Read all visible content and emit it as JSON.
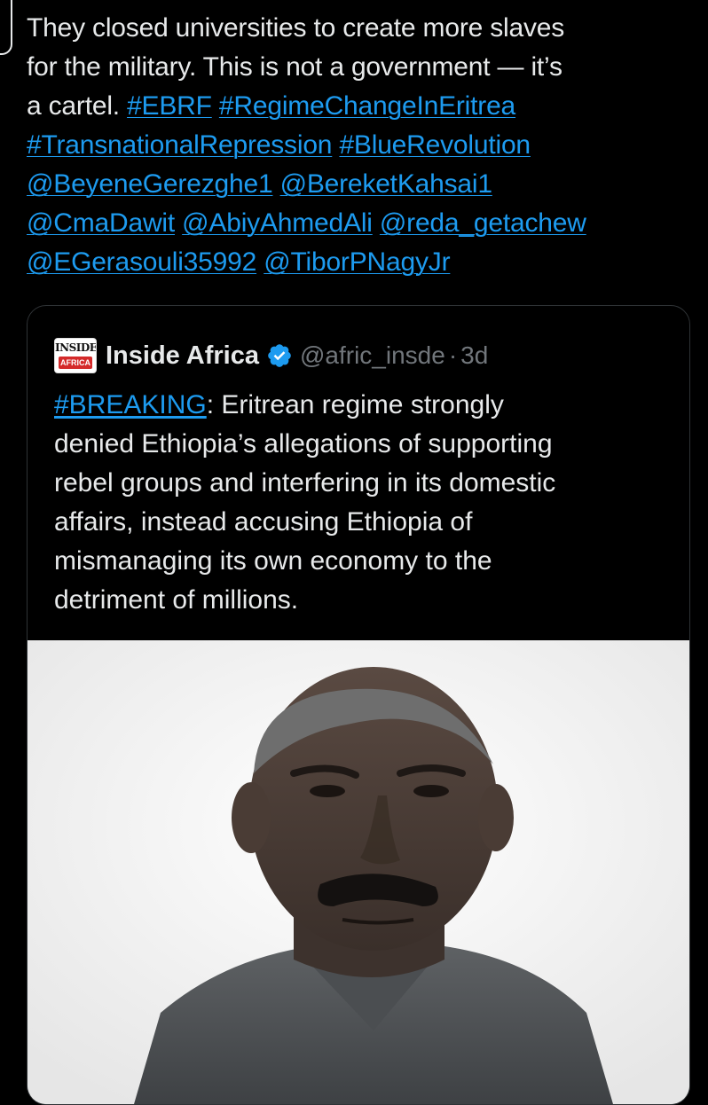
{
  "tweet": {
    "text_lines": [
      {
        "parts": [
          {
            "t": "They closed universities to create more slaves",
            "link": false
          }
        ]
      },
      {
        "parts": [
          {
            "t": "for the military. This is not a government — it’s",
            "link": false
          }
        ]
      },
      {
        "parts": [
          {
            "t": "a cartel. ",
            "link": false
          },
          {
            "t": "#EBRF",
            "link": true
          },
          {
            "t": " ",
            "link": false
          },
          {
            "t": "#RegimeChangeInEritrea",
            "link": true
          }
        ]
      },
      {
        "parts": [
          {
            "t": "#TransnationalRepression",
            "link": true
          },
          {
            "t": " ",
            "link": false
          },
          {
            "t": "#BlueRevolution",
            "link": true
          }
        ]
      },
      {
        "parts": [
          {
            "t": "@BeyeneGerezghe1",
            "link": true
          },
          {
            "t": " ",
            "link": false
          },
          {
            "t": "@BereketKahsai1",
            "link": true
          }
        ]
      },
      {
        "parts": [
          {
            "t": "@CmaDawit",
            "link": true
          },
          {
            "t": " ",
            "link": false
          },
          {
            "t": "@AbiyAhmedAli",
            "link": true
          },
          {
            "t": " ",
            "link": false
          },
          {
            "t": "@reda_getachew",
            "link": true
          }
        ]
      },
      {
        "parts": [
          {
            "t": "@EGerasouli35992",
            "link": true
          },
          {
            "t": " ",
            "link": false
          },
          {
            "t": "@TiborPNagyJr",
            "link": true
          }
        ]
      }
    ]
  },
  "quote": {
    "avatar_top": "INSIDE",
    "avatar_bottom": "AFRICA",
    "name": "Inside Africa",
    "handle": "@afric_insde",
    "separator": "·",
    "time": "3d",
    "text_lines": [
      {
        "parts": [
          {
            "t": "#BREAKING",
            "link": true
          },
          {
            "t": ": Eritrean regime  strongly",
            "link": false
          }
        ]
      },
      {
        "parts": [
          {
            "t": "denied Ethiopia’s allegations of supporting",
            "link": false
          }
        ]
      },
      {
        "parts": [
          {
            "t": "rebel groups and interfering in its domestic",
            "link": false
          }
        ]
      },
      {
        "parts": [
          {
            "t": "affairs, instead accusing Ethiopia of",
            "link": false
          }
        ]
      },
      {
        "parts": [
          {
            "t": "mismanaging its own economy to the",
            "link": false
          }
        ]
      },
      {
        "parts": [
          {
            "t": "detriment of millions.",
            "link": false
          }
        ]
      }
    ]
  },
  "colors": {
    "background": "#000000",
    "text": "#e7e9ea",
    "link": "#1d9bf0",
    "muted": "#71767b",
    "border": "#2f3336",
    "verified": "#1d9bf0"
  },
  "icons": {
    "verified": "verified-badge-icon",
    "avatar": "inside-africa-logo"
  }
}
